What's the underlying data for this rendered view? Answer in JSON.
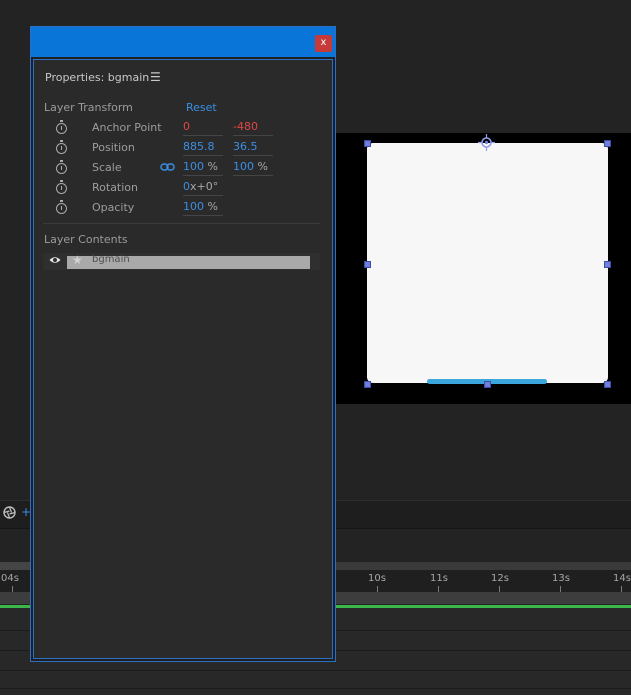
{
  "properties_panel": {
    "title": "Properties: bgmain",
    "close_label": "x",
    "layer_transform": {
      "header": "Layer Transform",
      "reset_label": "Reset",
      "anchor_point": {
        "label": "Anchor Point",
        "x": "0",
        "y": "-480"
      },
      "position": {
        "label": "Position",
        "x": "885.8",
        "y": "36.5"
      },
      "scale": {
        "label": "Scale",
        "x": "100",
        "y": "100",
        "unit": "%",
        "linked": true
      },
      "rotation": {
        "label": "Rotation",
        "value": "0",
        "turns_suffix": "x+0",
        "unit": "°"
      },
      "opacity": {
        "label": "Opacity",
        "value": "100",
        "unit": "%"
      }
    },
    "layer_contents": {
      "header": "Layer Contents",
      "layers": [
        {
          "name": "bgmain",
          "visible": true,
          "starred": true
        }
      ]
    }
  },
  "timeline": {
    "ruler_labels": [
      "04s",
      "10s",
      "11s",
      "12s",
      "13s",
      "14s"
    ],
    "toolbar_plus": "+"
  },
  "colors": {
    "accent_blue": "#3b8ee4",
    "titlebar_blue": "#0a75d8",
    "close_red": "#c63a3a",
    "value_red": "#e04646",
    "timeline_green": "#3cb64a",
    "artboard_bar": "#3aa6dc"
  }
}
